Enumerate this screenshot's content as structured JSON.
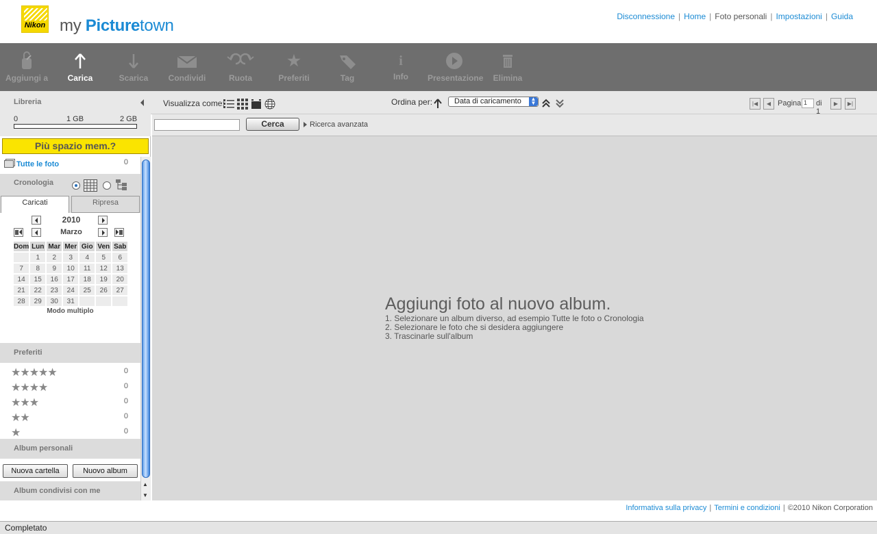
{
  "header": {
    "logo_text": "Nikon",
    "brand": {
      "my": "my ",
      "picture": "Picture",
      "town": "town"
    },
    "links": [
      "Disconnessione",
      "Home",
      "Foto personali",
      "Impostazioni",
      "Guida"
    ]
  },
  "toolbar": {
    "items": [
      {
        "label": "Aggiungi a",
        "icon": "add-to-icon"
      },
      {
        "label": "Carica",
        "icon": "upload-icon"
      },
      {
        "label": "Scarica",
        "icon": "download-icon"
      },
      {
        "label": "Condividi",
        "icon": "mail-icon"
      },
      {
        "label": "Ruota",
        "icon": "rotate-icon"
      },
      {
        "label": "Preferiti",
        "icon": "star-icon"
      },
      {
        "label": "Tag",
        "icon": "tag-icon"
      },
      {
        "label": "Info",
        "icon": "info-icon"
      },
      {
        "label": "Presentazione",
        "icon": "play-icon"
      },
      {
        "label": "Elimina",
        "icon": "trash-icon"
      }
    ]
  },
  "sidebar": {
    "library_title": "Libreria",
    "storage": {
      "ticks": [
        "0",
        "1 GB",
        "2 GB"
      ],
      "used_fraction": 0.0
    },
    "more_space": "Più spazio mem.?",
    "all_photos": {
      "label": "Tutte le foto",
      "count": "0"
    },
    "chronology_title": "Cronologia",
    "tabs": [
      "Caricati",
      "Ripresa"
    ],
    "calendar": {
      "year": "2010",
      "month": "Marzo",
      "weekdays": [
        "Dom",
        "Lun",
        "Mar",
        "Mer",
        "Gio",
        "Ven",
        "Sab"
      ],
      "weeks": [
        [
          "",
          "1",
          "2",
          "3",
          "4",
          "5",
          "6"
        ],
        [
          "7",
          "8",
          "9",
          "10",
          "11",
          "12",
          "13"
        ],
        [
          "14",
          "15",
          "16",
          "17",
          "18",
          "19",
          "20"
        ],
        [
          "21",
          "22",
          "23",
          "24",
          "25",
          "26",
          "27"
        ],
        [
          "28",
          "29",
          "30",
          "31",
          "",
          "",
          ""
        ]
      ],
      "multi_mode": "Modo multiplo"
    },
    "favorites_title": "Preferiti",
    "favorites": [
      {
        "stars": "★★★★★",
        "count": "0"
      },
      {
        "stars": "★★★★",
        "count": "0"
      },
      {
        "stars": "★★★",
        "count": "0"
      },
      {
        "stars": "★★",
        "count": "0"
      },
      {
        "stars": "★",
        "count": "0"
      }
    ],
    "personal_albums_title": "Album personali",
    "new_folder": "Nuova cartella",
    "new_album": "Nuovo album",
    "shared_albums_title": "Album condivisi con me"
  },
  "viewbar": {
    "view_as": "Visualizza come:",
    "sort_by": "Ordina per:",
    "sort_value": "Data di caricamento",
    "page_label": "Pagina",
    "page_value": "1",
    "page_of": "di 1"
  },
  "search": {
    "placeholder": "",
    "button": "Cerca",
    "advanced": "Ricerca avanzata"
  },
  "content": {
    "heading": "Aggiungi foto al nuovo album.",
    "steps": [
      "1. Selezionare un album diverso, ad esempio Tutte le foto o Cronologia",
      "2. Selezionare le foto che si desidera aggiungere",
      "3. Trascinarle sull'album"
    ]
  },
  "footer": {
    "privacy": "Informativa sulla privacy",
    "terms": "Termini e condizioni",
    "copyright": "©2010 Nikon Corporation"
  },
  "status_bar": "Completato"
}
